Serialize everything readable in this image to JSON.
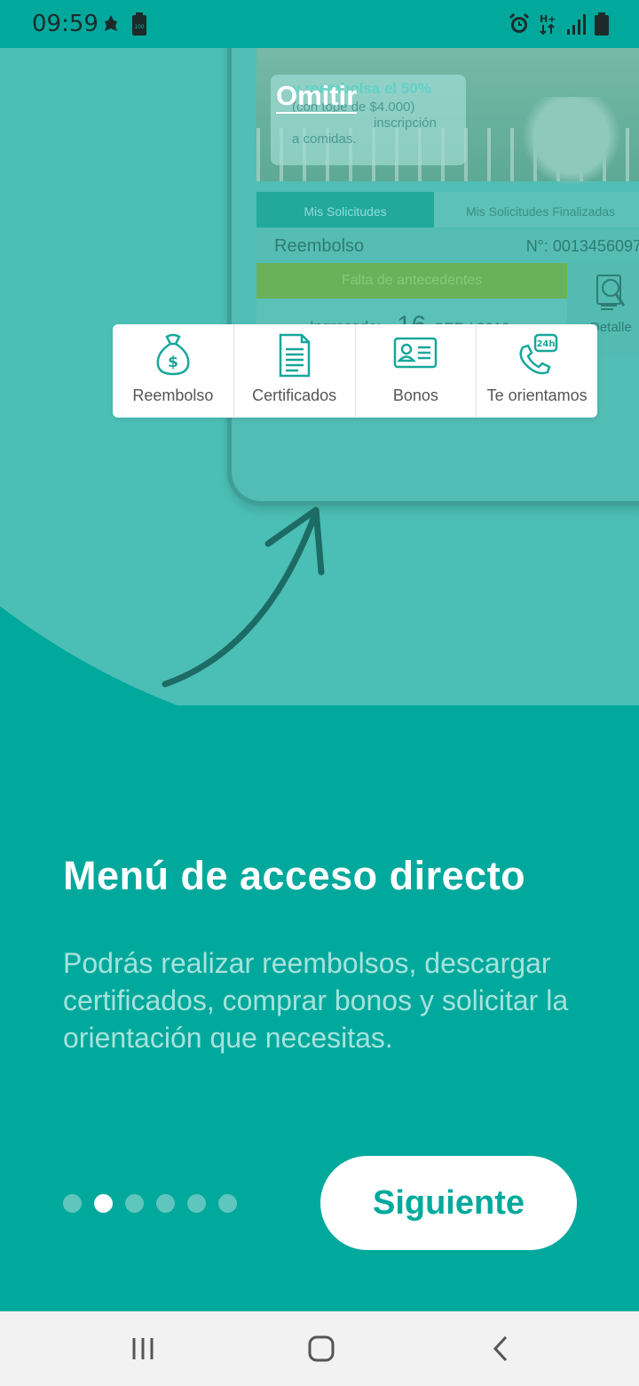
{
  "status_bar": {
    "time": "09:59",
    "icons": [
      "android-debug-icon",
      "battery-saver-icon",
      "alarm-icon",
      "network-h-plus-icon",
      "signal-icon",
      "battery-icon"
    ],
    "battery_small_label": "100"
  },
  "onboarding": {
    "skip_label": "Omitir",
    "title": "Menú de acceso directo",
    "description": "Podrás realizar reembolsos, descargar certificados, comprar bonos y solicitar la orientación que necesitas.",
    "next_label": "Siguiente",
    "page_count": 6,
    "current_page": 2
  },
  "mockup": {
    "banner": {
      "line1": "y reembolsa el 50%",
      "line2": "(con tope de $4.000)",
      "line3": "inscripción",
      "line4": "a comidas."
    },
    "tabs": [
      "Mis Solicitudes",
      "Mis Solicitudes Finalizadas"
    ],
    "request": {
      "type": "Reembolso",
      "number": "N°: 0013456097",
      "status": "Falta de antecedentes",
      "date_label": "Ingresado:",
      "date_day": "16",
      "date_rest": "SEP / 2019",
      "detail_label": "Detalle"
    }
  },
  "quick_menu": [
    {
      "label": "Reembolso",
      "icon": "money-bag-icon"
    },
    {
      "label": "Certificados",
      "icon": "document-icon"
    },
    {
      "label": "Bonos",
      "icon": "id-card-icon"
    },
    {
      "label": "Te orientamos",
      "icon": "phone-24h-icon"
    }
  ],
  "colors": {
    "primary": "#00a99c",
    "circle": "#4bbfb5",
    "white": "#ffffff",
    "description": "#a6e2dc"
  },
  "nav_bar": {
    "buttons": [
      "recents-icon",
      "home-icon",
      "back-icon"
    ]
  }
}
